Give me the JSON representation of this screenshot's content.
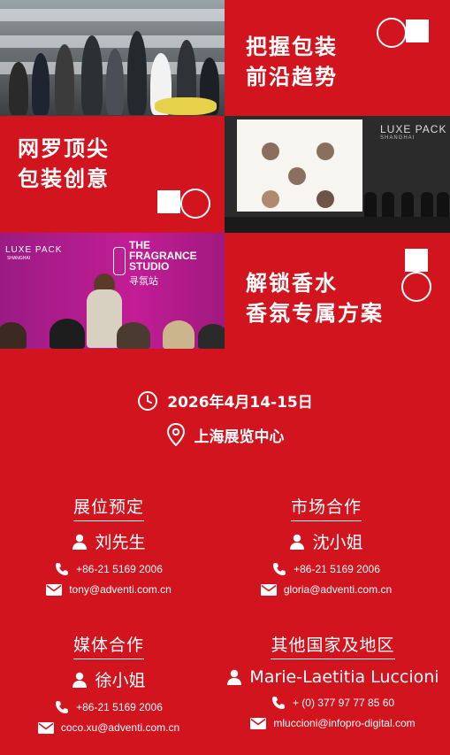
{
  "headlines": {
    "trends_line1": "把握包装",
    "trends_line2": "前沿趋势",
    "creativity_line1": "网罗顶尖",
    "creativity_line2": "包装创意",
    "fragrance_line1": "解锁香水",
    "fragrance_line2": "香氛专属方案"
  },
  "photos": {
    "conference_logo": "LUXE PACK",
    "conference_logo_city": "SHANGHAI",
    "studio_logo": "LUXE PACK",
    "studio_logo_city": "SHANGHAI",
    "studio_name_line1": "THE",
    "studio_name_line2": "FRAGRANCE",
    "studio_name_line3": "STUDIO",
    "studio_name_cn": "寻氛站"
  },
  "event": {
    "date": "2026年4月14-15日",
    "venue": "上海展览中心"
  },
  "contacts": [
    {
      "title": "展位预定",
      "name": "刘先生",
      "phone": "+86-21 5169 2006",
      "email": "tony@adventi.com.cn"
    },
    {
      "title": "市场合作",
      "name": "沈小姐",
      "phone": "+86-21 5169 2006",
      "email": "gloria@adventi.com.cn"
    },
    {
      "title": "媒体合作",
      "name": "徐小姐",
      "phone": "+86-21 5169 2006",
      "email": "coco.xu@adventi.com.cn"
    },
    {
      "title": "其他国家及地区",
      "name": "Marie-Laetitia Luccioni",
      "phone": "+ (0) 377 97 77 85 60",
      "email": "mluccioni@infopro-digital.com"
    }
  ],
  "colors": {
    "background": "#d2141f",
    "text": "#ffffff"
  },
  "icons": [
    "clock-icon",
    "location-pin-icon",
    "user-icon",
    "phone-icon",
    "mail-icon"
  ]
}
